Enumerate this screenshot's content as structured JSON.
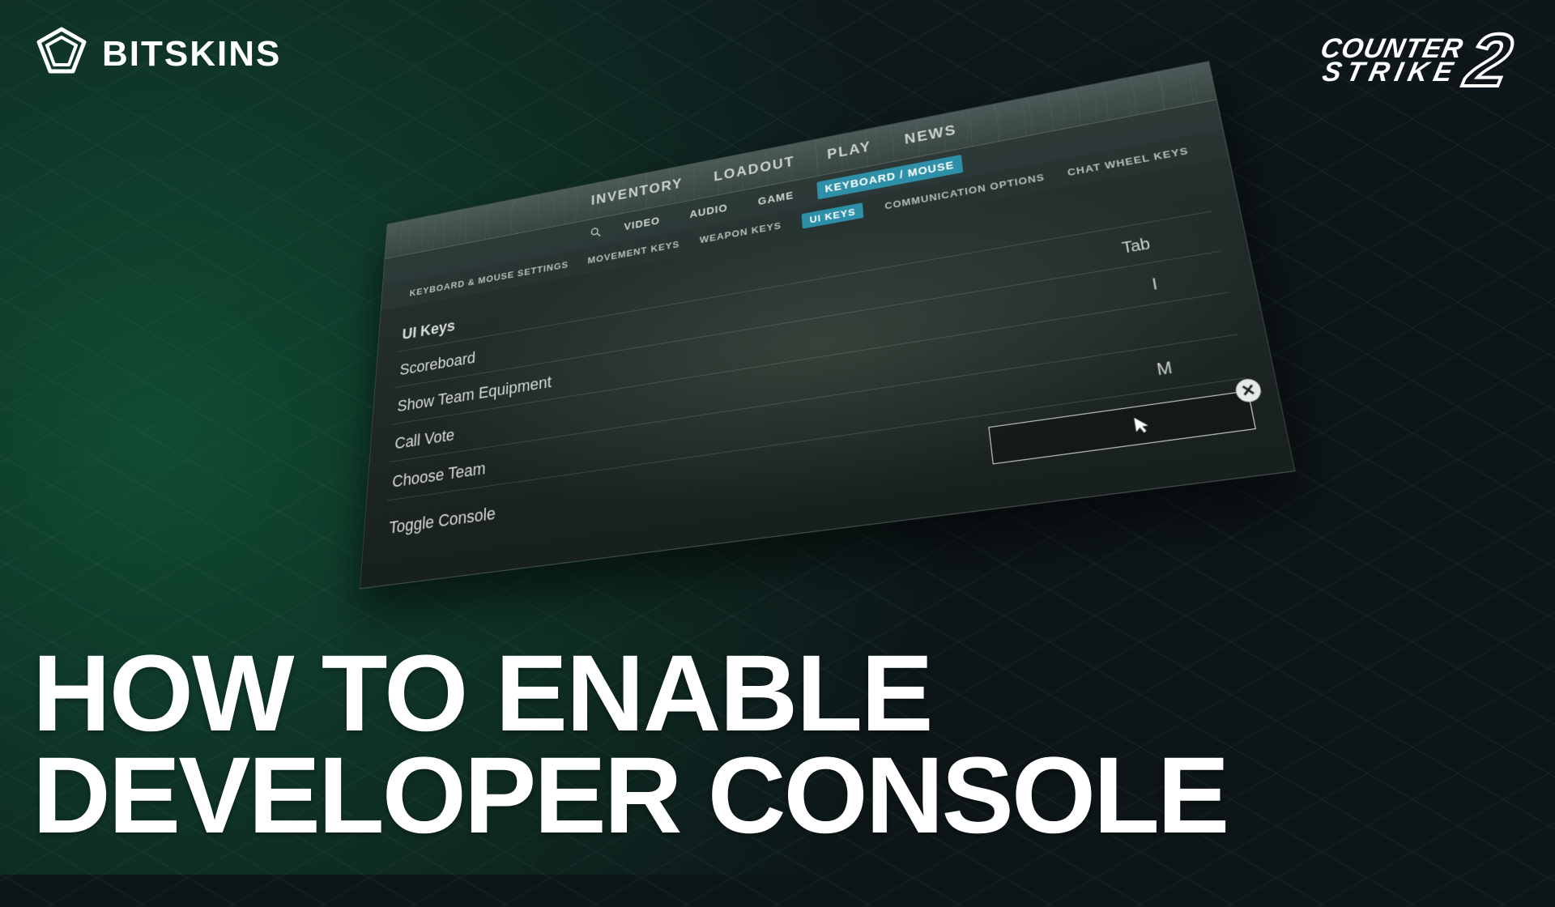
{
  "brand": {
    "name": "BITSKINS"
  },
  "game_logo": {
    "line1": "COUNTER",
    "line2": "STRIKE",
    "two": "2"
  },
  "topnav": {
    "items": [
      "INVENTORY",
      "LOADOUT",
      "PLAY",
      "NEWS"
    ]
  },
  "category_tabs": {
    "items": [
      "VIDEO",
      "AUDIO",
      "GAME",
      "KEYBOARD / MOUSE"
    ],
    "active_index": 3
  },
  "sub_tabs": {
    "items": [
      "KEYBOARD & MOUSE SETTINGS",
      "MOVEMENT KEYS",
      "WEAPON KEYS",
      "UI KEYS",
      "COMMUNICATION OPTIONS",
      "CHAT WHEEL KEYS"
    ],
    "active_index": 3
  },
  "settings": {
    "section": "UI Keys",
    "rows": [
      {
        "label": "Scoreboard",
        "value": "Tab"
      },
      {
        "label": "Show Team Equipment",
        "value": "I"
      },
      {
        "label": "Call Vote",
        "value": ""
      },
      {
        "label": "Choose Team",
        "value": "M"
      },
      {
        "label": "Toggle Console",
        "value": ""
      }
    ],
    "selected_row_index": 3
  },
  "headline": {
    "line1": "HOW TO ENABLE",
    "line2": "DEVELOPER CONSOLE"
  },
  "icons": {
    "close": "✕"
  }
}
